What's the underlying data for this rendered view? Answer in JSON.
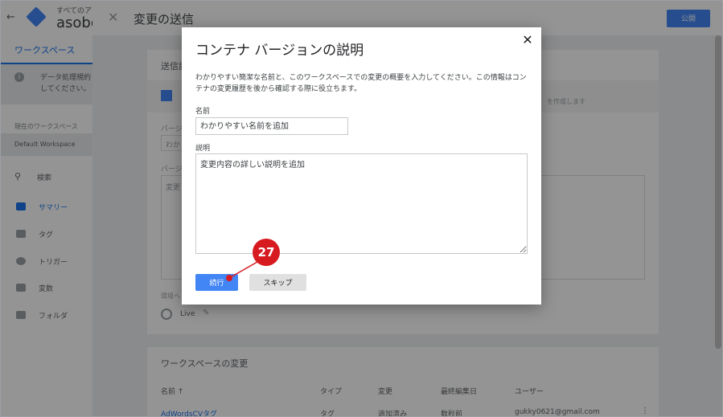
{
  "sidebar": {
    "account_sub": "すべてのア",
    "account_name": "asobou",
    "workspace_tab": "ワークスペース",
    "notice": [
      "データ処理規約",
      "してください。"
    ],
    "current_workspace_label": "現在のワークスペース",
    "current_workspace_value": "Default Workspace",
    "search_label": "検索",
    "nav": [
      {
        "label": "サマリー",
        "icon": "folder-icon"
      },
      {
        "label": "タグ",
        "icon": "tag-icon"
      },
      {
        "label": "トリガー",
        "icon": "trigger-icon"
      },
      {
        "label": "変数",
        "icon": "variable-icon"
      },
      {
        "label": "フォルダ",
        "icon": "folder-icon"
      }
    ]
  },
  "panel": {
    "title": "変更の送信",
    "publish_label": "公開",
    "card_title": "送信設",
    "row_text": "を作成します",
    "label_version_name": "バージ",
    "input_version_name_ph": "わか",
    "label_version_desc": "バージ",
    "textarea_version_desc_ph": "変更",
    "env_label": "環境へ",
    "env_live": "Live"
  },
  "changes": {
    "title": "ワークスペースの変更",
    "headers": [
      "名前 ↑",
      "タイプ",
      "変更",
      "最終編集日",
      "ユーザー"
    ],
    "row": [
      "AdWordsCVタグ",
      "タグ",
      "追加済み",
      "数秒前",
      "gukky0621@gmail.com"
    ]
  },
  "dialog": {
    "title": "コンテナ バージョンの説明",
    "description": "わかりやすい簡潔な名前と、このワークスペースでの変更の概要を入力してください。この情報はコンテナの変更履歴を後から確認する際に役立ちます。",
    "name_label": "名前",
    "name_placeholder": "わかりやすい名前を追加",
    "desc_label": "説明",
    "desc_placeholder": "変更内容の詳しい説明を追加",
    "continue_label": "続行",
    "skip_label": "スキップ"
  },
  "annotation": {
    "number": "27",
    "color": "#d71920"
  },
  "colors": {
    "primary": "#4285f4",
    "link": "#1a73e8"
  }
}
